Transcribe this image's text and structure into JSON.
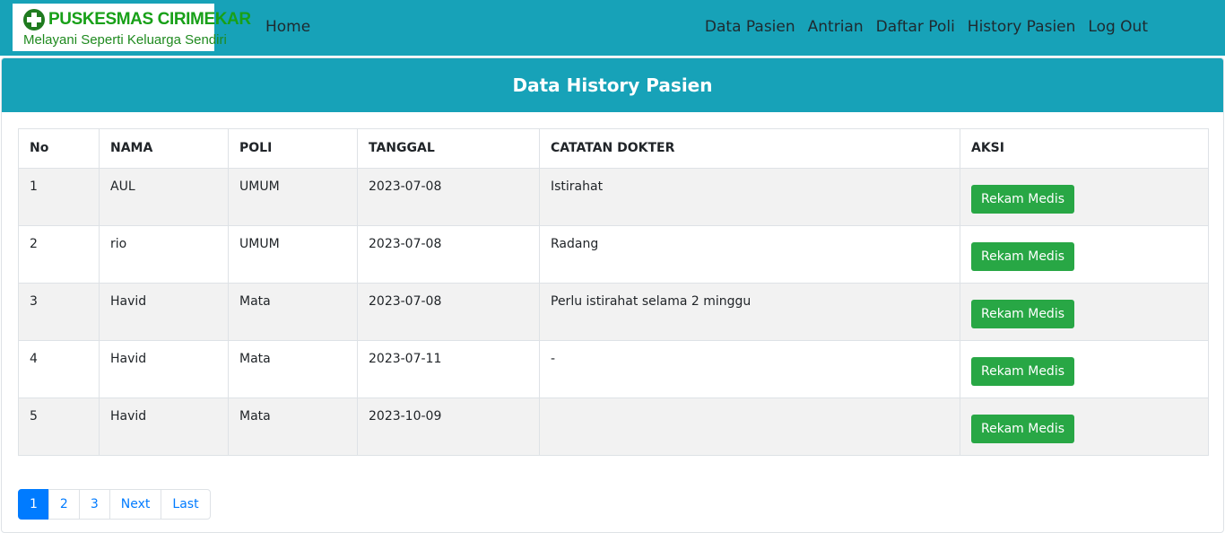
{
  "brand": {
    "title": "PUSKESMAS CIRIMEKAR",
    "subtitle": "Melayani Seperti Keluarga Sendiri"
  },
  "nav": {
    "home": "Home",
    "items": [
      "Data Pasien",
      "Antrian",
      "Daftar Poli",
      "History Pasien",
      "Log Out"
    ]
  },
  "page": {
    "title": "Data History Pasien"
  },
  "table": {
    "headers": [
      "No",
      "NAMA",
      "POLI",
      "TANGGAL",
      "CATATAN DOKTER",
      "AKSI"
    ],
    "rows": [
      {
        "no": "1",
        "nama": "AUL",
        "poli": "UMUM",
        "tanggal": "2023-07-08",
        "catatan": "Istirahat",
        "aksi": "Rekam Medis"
      },
      {
        "no": "2",
        "nama": "rio",
        "poli": "UMUM",
        "tanggal": "2023-07-08",
        "catatan": "Radang",
        "aksi": "Rekam Medis"
      },
      {
        "no": "3",
        "nama": "Havid",
        "poli": "Mata",
        "tanggal": "2023-07-08",
        "catatan": "Perlu istirahat selama 2 minggu",
        "aksi": "Rekam Medis"
      },
      {
        "no": "4",
        "nama": "Havid",
        "poli": "Mata",
        "tanggal": "2023-07-11",
        "catatan": "-",
        "aksi": "Rekam Medis"
      },
      {
        "no": "5",
        "nama": "Havid",
        "poli": "Mata",
        "tanggal": "2023-10-09",
        "catatan": "",
        "aksi": "Rekam Medis"
      }
    ]
  },
  "pagination": {
    "pages": [
      "1",
      "2",
      "3"
    ],
    "next": "Next",
    "last": "Last",
    "active": "1"
  },
  "colors": {
    "header": "#17a2b8",
    "button": "#28a745",
    "pagination_active": "#007bff"
  }
}
